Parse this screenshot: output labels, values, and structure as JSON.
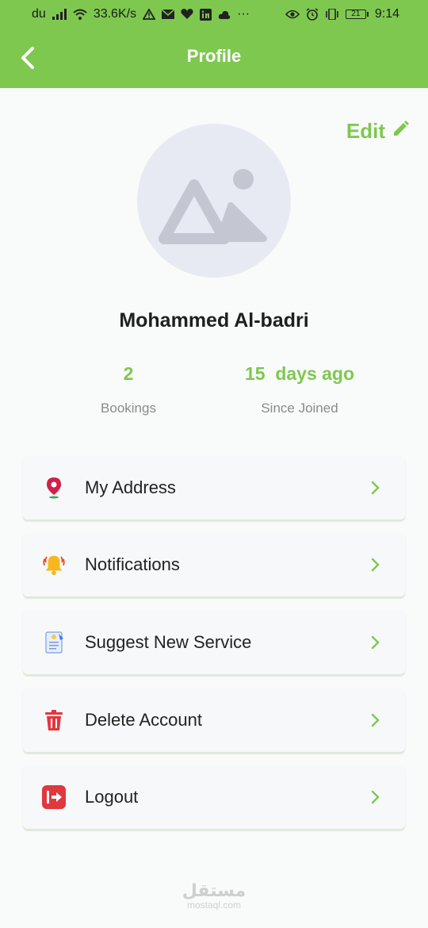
{
  "status_bar": {
    "carrier": "du",
    "speed": "33.6K/s",
    "more": "···",
    "battery": "21",
    "time": "9:14"
  },
  "app_bar": {
    "title": "Profile"
  },
  "profile": {
    "edit_label": "Edit",
    "name": "Mohammed Al-badri",
    "stats": [
      {
        "value": "2",
        "label": "Bookings"
      },
      {
        "value": "15  days ago",
        "label": "Since Joined"
      }
    ]
  },
  "menu": {
    "items": [
      {
        "label": "My Address",
        "icon": "location-pin-icon"
      },
      {
        "label": "Notifications",
        "icon": "bell-icon"
      },
      {
        "label": "Suggest New Service",
        "icon": "document-icon"
      },
      {
        "label": "Delete Account",
        "icon": "trash-icon"
      },
      {
        "label": "Logout",
        "icon": "logout-icon"
      }
    ]
  },
  "watermark": {
    "arabic": "مستقل",
    "latin": "mostaql.com"
  },
  "colors": {
    "accent": "#7ec850",
    "avatar_bg": "#e8eaf3",
    "danger": "#e0383e"
  }
}
